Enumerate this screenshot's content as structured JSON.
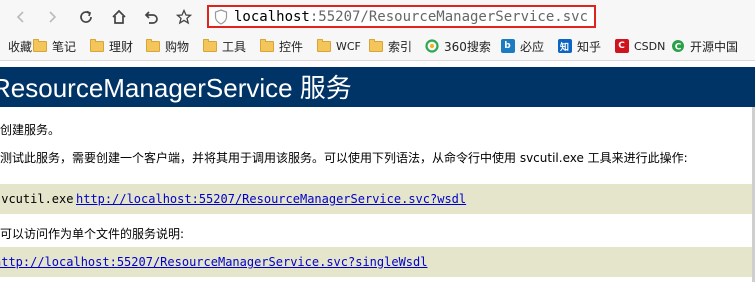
{
  "browser": {
    "address": {
      "host": "localhost",
      "port_path": ":55207/ResourceManagerService.svc"
    }
  },
  "bookmarks": [
    {
      "label": "收藏",
      "icon": "star-icon"
    },
    {
      "label": "笔记",
      "icon": "folder-icon"
    },
    {
      "label": "理财",
      "icon": "folder-icon"
    },
    {
      "label": "购物",
      "icon": "folder-icon"
    },
    {
      "label": "工具",
      "icon": "folder-icon"
    },
    {
      "label": "控件",
      "icon": "folder-icon"
    },
    {
      "label": "WCF",
      "icon": "folder-icon"
    },
    {
      "label": "索引",
      "icon": "folder-icon"
    },
    {
      "label": "360搜索",
      "icon": "360-search-icon"
    },
    {
      "label": "必应",
      "icon": "bing-icon"
    },
    {
      "label": "知乎",
      "icon": "zhihu-icon"
    },
    {
      "label": "CSDN",
      "icon": "csdn-icon"
    },
    {
      "label": "开源中国",
      "icon": "oschina-icon"
    }
  ],
  "page": {
    "title": "ResourceManagerService 服务",
    "intro": "您已创建服务。",
    "instruction": "若要测试此服务，需要创建一个客户端，并将其用于调用该服务。可以使用下列语法，从命令行中使用 svcutil.exe 工具来进行此操作:",
    "command_prefix": "svcutil.exe",
    "wsdl_link": "http://localhost:55207/ResourceManagerService.svc?wsdl",
    "single_wsdl_intro": "您还可以访问作为单个文件的服务说明:",
    "single_wsdl_link": "http://localhost:55207/ResourceManagerService.svc?singleWsdl"
  },
  "colors": {
    "header_bg": "#003366",
    "code_bg": "#e5e5cc",
    "link": "#0000cc",
    "address_highlight": "#e0231c"
  }
}
